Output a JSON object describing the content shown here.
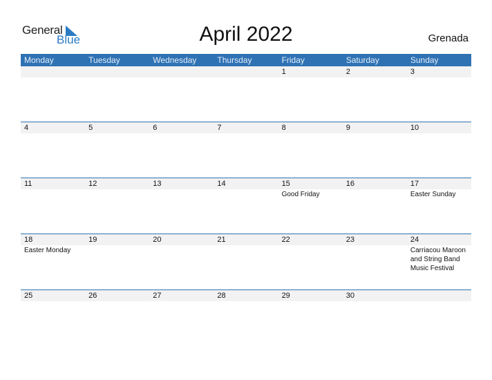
{
  "logo": {
    "general": "General",
    "blue": "Blue"
  },
  "title": "April 2022",
  "country": "Grenada",
  "colors": {
    "header": "#2e72b4",
    "strip": "#f2f2f2",
    "logo_blue": "#2a7bc4"
  },
  "weekdays": [
    "Monday",
    "Tuesday",
    "Wednesday",
    "Thursday",
    "Friday",
    "Saturday",
    "Sunday"
  ],
  "weeks": [
    [
      {
        "d": ""
      },
      {
        "d": ""
      },
      {
        "d": ""
      },
      {
        "d": ""
      },
      {
        "d": "1"
      },
      {
        "d": "2"
      },
      {
        "d": "3"
      }
    ],
    [
      {
        "d": "4"
      },
      {
        "d": "5"
      },
      {
        "d": "6"
      },
      {
        "d": "7"
      },
      {
        "d": "8"
      },
      {
        "d": "9"
      },
      {
        "d": "10"
      }
    ],
    [
      {
        "d": "11"
      },
      {
        "d": "12"
      },
      {
        "d": "13"
      },
      {
        "d": "14"
      },
      {
        "d": "15",
        "e": "Good Friday"
      },
      {
        "d": "16"
      },
      {
        "d": "17",
        "e": "Easter Sunday"
      }
    ],
    [
      {
        "d": "18",
        "e": "Easter Monday"
      },
      {
        "d": "19"
      },
      {
        "d": "20"
      },
      {
        "d": "21"
      },
      {
        "d": "22"
      },
      {
        "d": "23"
      },
      {
        "d": "24",
        "e": "Carriacou Maroon and String Band Music Festival"
      }
    ],
    [
      {
        "d": "25"
      },
      {
        "d": "26"
      },
      {
        "d": "27"
      },
      {
        "d": "28"
      },
      {
        "d": "29"
      },
      {
        "d": "30"
      },
      {
        "d": ""
      }
    ]
  ]
}
